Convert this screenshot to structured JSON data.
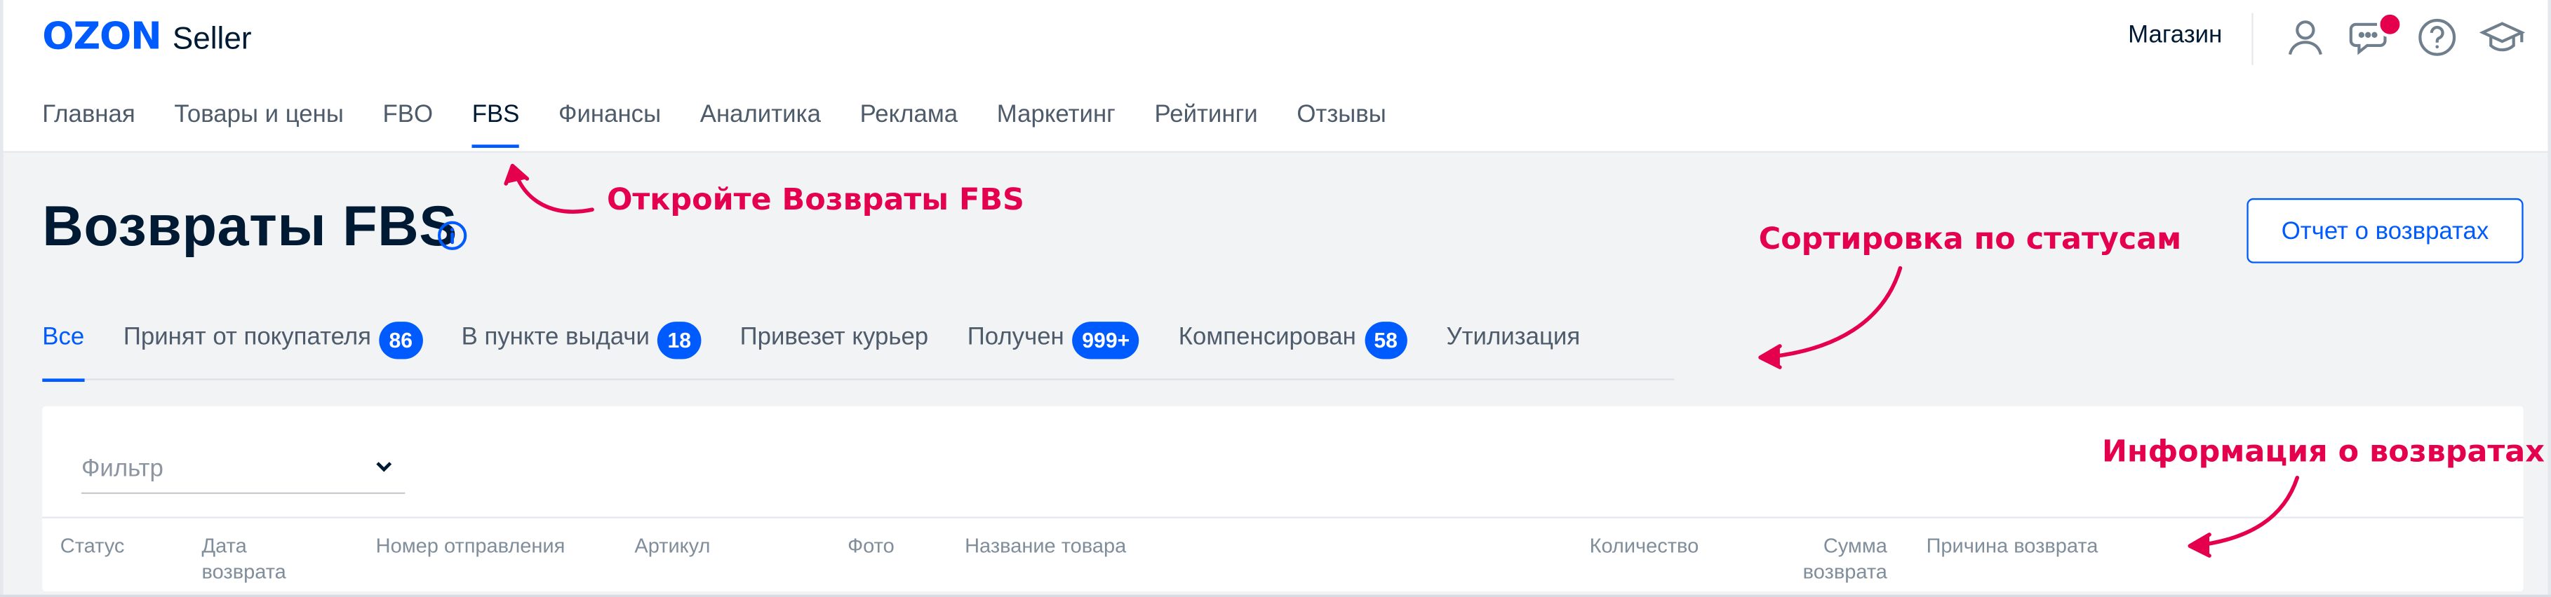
{
  "colors": {
    "accent": "#005bff",
    "annotation": "#e5004d",
    "notification": "#e5004d"
  },
  "header": {
    "logo_brand": "OZON",
    "logo_product": "Seller",
    "store_label": "Магазин",
    "icons": [
      "user-icon",
      "chat-icon",
      "help-icon",
      "education-icon"
    ],
    "nav": [
      {
        "label": "Главная"
      },
      {
        "label": "Товары и цены"
      },
      {
        "label": "FBO"
      },
      {
        "label": "FBS"
      },
      {
        "label": "Финансы"
      },
      {
        "label": "Аналитика"
      },
      {
        "label": "Реклама"
      },
      {
        "label": "Маркетинг"
      },
      {
        "label": "Рейтинги"
      },
      {
        "label": "Отзывы"
      }
    ],
    "active_nav": "FBS"
  },
  "page": {
    "title": "Возвраты FBS",
    "report_button": "Отчет о возвратах",
    "tabs": [
      {
        "label": "Все",
        "count": ""
      },
      {
        "label": "Принят от покупателя",
        "count": "86"
      },
      {
        "label": "В пункте выдачи",
        "count": "18"
      },
      {
        "label": "Привезет курьер",
        "count": ""
      },
      {
        "label": "Получен",
        "count": "999+"
      },
      {
        "label": "Компенсирован",
        "count": "58"
      },
      {
        "label": "Утилизация",
        "count": ""
      }
    ],
    "active_tab": "Все",
    "filter_placeholder": "Фильтр",
    "table_headers": {
      "status": "Статус",
      "return_date_1": "Дата",
      "return_date_2": "возврата",
      "shipment_number": "Номер отправления",
      "article": "Артикул",
      "photo": "Фото",
      "product_name": "Название товара",
      "quantity": "Количество",
      "return_sum_1": "Сумма",
      "return_sum_2": "возврата",
      "return_reason": "Причина возврата"
    }
  },
  "annotations": {
    "open_returns": "Откройте Возвраты FBS",
    "sort_by_status": "Сортировка по статусам",
    "returns_info": "Информация о возвратах"
  }
}
